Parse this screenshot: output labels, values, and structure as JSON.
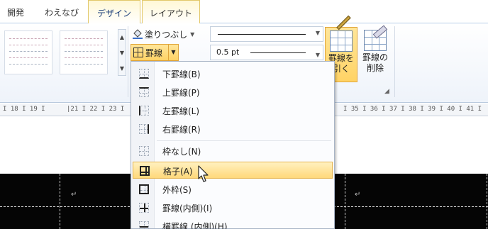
{
  "tabs": [
    {
      "label": "開発",
      "active": false
    },
    {
      "label": "わえなび",
      "active": false
    },
    {
      "label": "デザイン",
      "active": true
    },
    {
      "label": "レイアウト",
      "active": false
    }
  ],
  "ribbon": {
    "shading_label": "塗りつぶし",
    "borders_label": "罫線",
    "line_weight": "0.5 pt",
    "draw_table_label_1": "罫線を",
    "draw_table_label_2": "引く",
    "erase_label_1": "罫線の",
    "erase_label_2": "削除"
  },
  "ruler": [
    "I 18 I 19 I",
    "|21 I 22 I 23 I",
    "I 35 I 36 I 37 I 38 I 39 I 40 I 41 I"
  ],
  "borders_menu": {
    "items": [
      {
        "label": "下罫線(B)",
        "icon": "border-bottom-icon"
      },
      {
        "label": "上罫線(P)",
        "icon": "border-top-icon"
      },
      {
        "label": "左罫線(L)",
        "icon": "border-left-icon"
      },
      {
        "label": "右罫線(R)",
        "icon": "border-right-icon"
      },
      {
        "label": "枠なし(N)",
        "icon": "no-border-icon"
      },
      {
        "label": "格子(A)",
        "icon": "all-borders-icon",
        "highlighted": true
      },
      {
        "label": "外枠(S)",
        "icon": "outside-borders-icon"
      },
      {
        "label": "罫線(内側)(I)",
        "icon": "inside-borders-icon"
      },
      {
        "label": "横罫線 (内側)(H)",
        "icon": "inside-horizontal-border-icon"
      }
    ]
  },
  "document": {
    "paragraph_mark": "↵"
  },
  "colors": {
    "highlight": "#ffd87a",
    "accent_border": "#e5b34d",
    "table_fill": "#050505"
  }
}
